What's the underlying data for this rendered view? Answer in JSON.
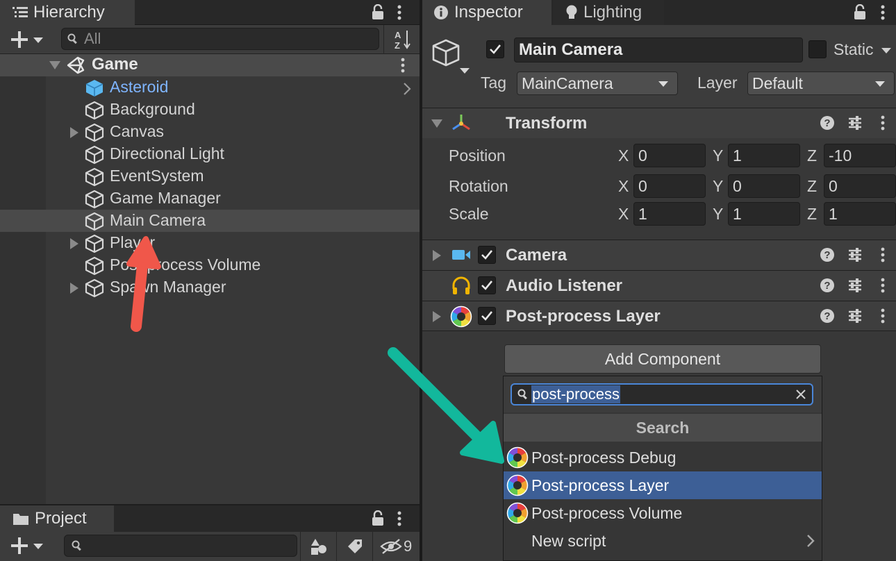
{
  "hierarchy": {
    "tab_label": "Hierarchy",
    "search_placeholder": "All",
    "scene_name": "Game",
    "items": [
      {
        "label": "Asteroid",
        "prefab": true,
        "foldable": false
      },
      {
        "label": "Background",
        "prefab": false,
        "foldable": false
      },
      {
        "label": "Canvas",
        "prefab": false,
        "foldable": true
      },
      {
        "label": "Directional Light",
        "prefab": false,
        "foldable": false
      },
      {
        "label": "EventSystem",
        "prefab": false,
        "foldable": false
      },
      {
        "label": "Game Manager",
        "prefab": false,
        "foldable": false
      },
      {
        "label": "Main Camera",
        "prefab": false,
        "foldable": false,
        "selected": true
      },
      {
        "label": "Player",
        "prefab": false,
        "foldable": true
      },
      {
        "label": "Post-process Volume",
        "prefab": false,
        "foldable": false
      },
      {
        "label": "Spawn Manager",
        "prefab": false,
        "foldable": true
      }
    ]
  },
  "inspector": {
    "tab_label": "Inspector",
    "lighting_tab_label": "Lighting",
    "object_name": "Main Camera",
    "static_label": "Static",
    "tag_label": "Tag",
    "tag_value": "MainCamera",
    "layer_label": "Layer",
    "layer_value": "Default",
    "transform": {
      "title": "Transform",
      "position_label": "Position",
      "rotation_label": "Rotation",
      "scale_label": "Scale",
      "x_label": "X",
      "y_label": "Y",
      "z_label": "Z",
      "position": {
        "x": "0",
        "y": "1",
        "z": "-10"
      },
      "rotation": {
        "x": "0",
        "y": "0",
        "z": "0"
      },
      "scale": {
        "x": "1",
        "y": "1",
        "z": "1"
      }
    },
    "components": [
      {
        "title": "Camera"
      },
      {
        "title": "Audio Listener"
      },
      {
        "title": "Post-process Layer"
      }
    ],
    "add_component_label": "Add Component"
  },
  "add_component_popup": {
    "search_value": "post-process",
    "section_header": "Search",
    "results": [
      {
        "label": "Post-process Debug"
      },
      {
        "label": "Post-process Layer",
        "selected": true
      },
      {
        "label": "Post-process Volume"
      },
      {
        "label": "New script"
      }
    ]
  },
  "project": {
    "tab_label": "Project",
    "hidden_count": "9"
  },
  "colors": {
    "accent_selection": "#3d5f96",
    "prefab_text": "#7fb5ff",
    "annotation_red": "#f0574a",
    "annotation_teal": "#12b89c"
  }
}
